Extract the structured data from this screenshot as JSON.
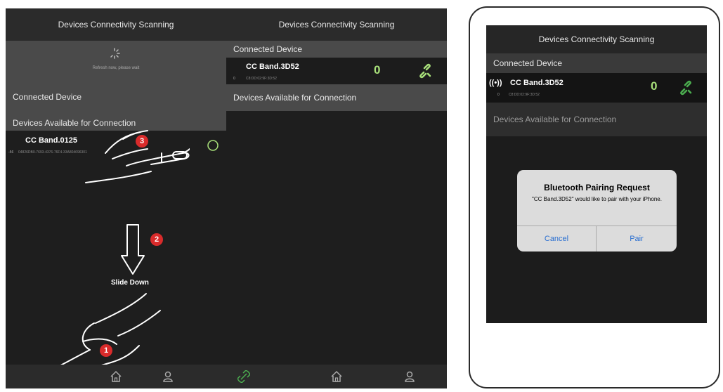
{
  "screen1": {
    "title": "Devices Connectivity Scanning",
    "refresh_text": "Refresh now, please wait",
    "connected_label": "Connected Device",
    "available_label": "Devices Available for Connection",
    "device": {
      "name": "CC Band.0125",
      "rssi": "-56",
      "id": "04826DB0-7693-4376-76F4-33A804696301"
    },
    "step3": "3",
    "step2": "2",
    "step1": "1",
    "slide_label": "Slide Down"
  },
  "screen2": {
    "title": "Devices Connectivity Scanning",
    "connected_label": "Connected Device",
    "available_label": "Devices Available for Connection",
    "device": {
      "name": "CC Band.3D52",
      "rssi": "0",
      "id": "C8:DD:02:9F:3D:52",
      "count": "0"
    }
  },
  "screen3": {
    "title": "Devices Connectivity Scanning",
    "connected_label": "Connected Device",
    "available_label": "Devices Available for Connection",
    "device": {
      "name": "CC Band.3D52",
      "rssi": "0",
      "id": "C8:DD:02:9F:3D:52",
      "count": "0"
    },
    "alert": {
      "title": "Bluetooth Pairing Request",
      "message": "\"CC Band.3D52\" would like to pair with your iPhone.",
      "cancel": "Cancel",
      "pair": "Pair"
    }
  },
  "colors": {
    "accent_green": "#a8e07a",
    "step_red": "#d92b2b",
    "ios_blue": "#2a6fd1"
  },
  "icons": {
    "tabs": [
      "link-icon",
      "home-icon",
      "profile-icon"
    ]
  }
}
